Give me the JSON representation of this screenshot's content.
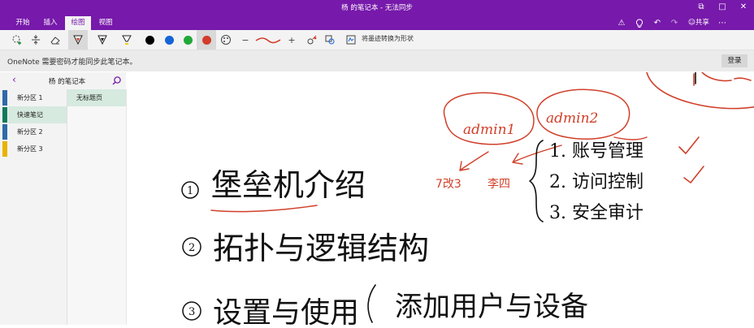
{
  "titlebar": {
    "title": "杨 的笔记本 - 无法同步",
    "tabs": [
      "开始",
      "插入",
      "绘图",
      "视图"
    ],
    "active_tab": "绘图",
    "share_label": "共享",
    "accent": "#7719aa"
  },
  "ribbon": {
    "tools": [
      "lasso-add-icon",
      "insert-space-icon",
      "eraser-icon",
      "pen-red-icon",
      "pen-black-icon",
      "highlighter-icon"
    ],
    "pen_colors": [
      "#000000",
      "#1565d8",
      "#21a83a",
      "#d33b2a"
    ],
    "ink_to_shape_label": "将墨迹转换为形状"
  },
  "notice": {
    "text": "OneNote 需要密码才能同步此笔记本。",
    "login_label": "登录"
  },
  "sidebar": {
    "notebook_title": "杨 的笔记本",
    "sections": [
      {
        "label": "新分区 1",
        "color": "#2e6ba8"
      },
      {
        "label": "快速笔记",
        "color": "#0f7a5a"
      },
      {
        "label": "新分区 2",
        "color": "#2e6ba8"
      },
      {
        "label": "新分区 3",
        "color": "#e8b400"
      }
    ],
    "selected_section": "快速笔记",
    "pages": [
      "无标题页"
    ]
  },
  "canvas": {
    "ink_black": "#111111",
    "ink_red": "#d0402a",
    "handwriting": {
      "item1": "堡垒机介绍",
      "item2": "拓扑与逻辑结构",
      "item3": "设置与使用",
      "item3_sub": "添加用户与设备",
      "bubble1": "admin1",
      "bubble2": "admin2",
      "red_left": "7改3",
      "red_mid": "李四",
      "list": [
        "1. 账号管理",
        "2. 访问控制",
        "3. 安全审计"
      ]
    }
  }
}
